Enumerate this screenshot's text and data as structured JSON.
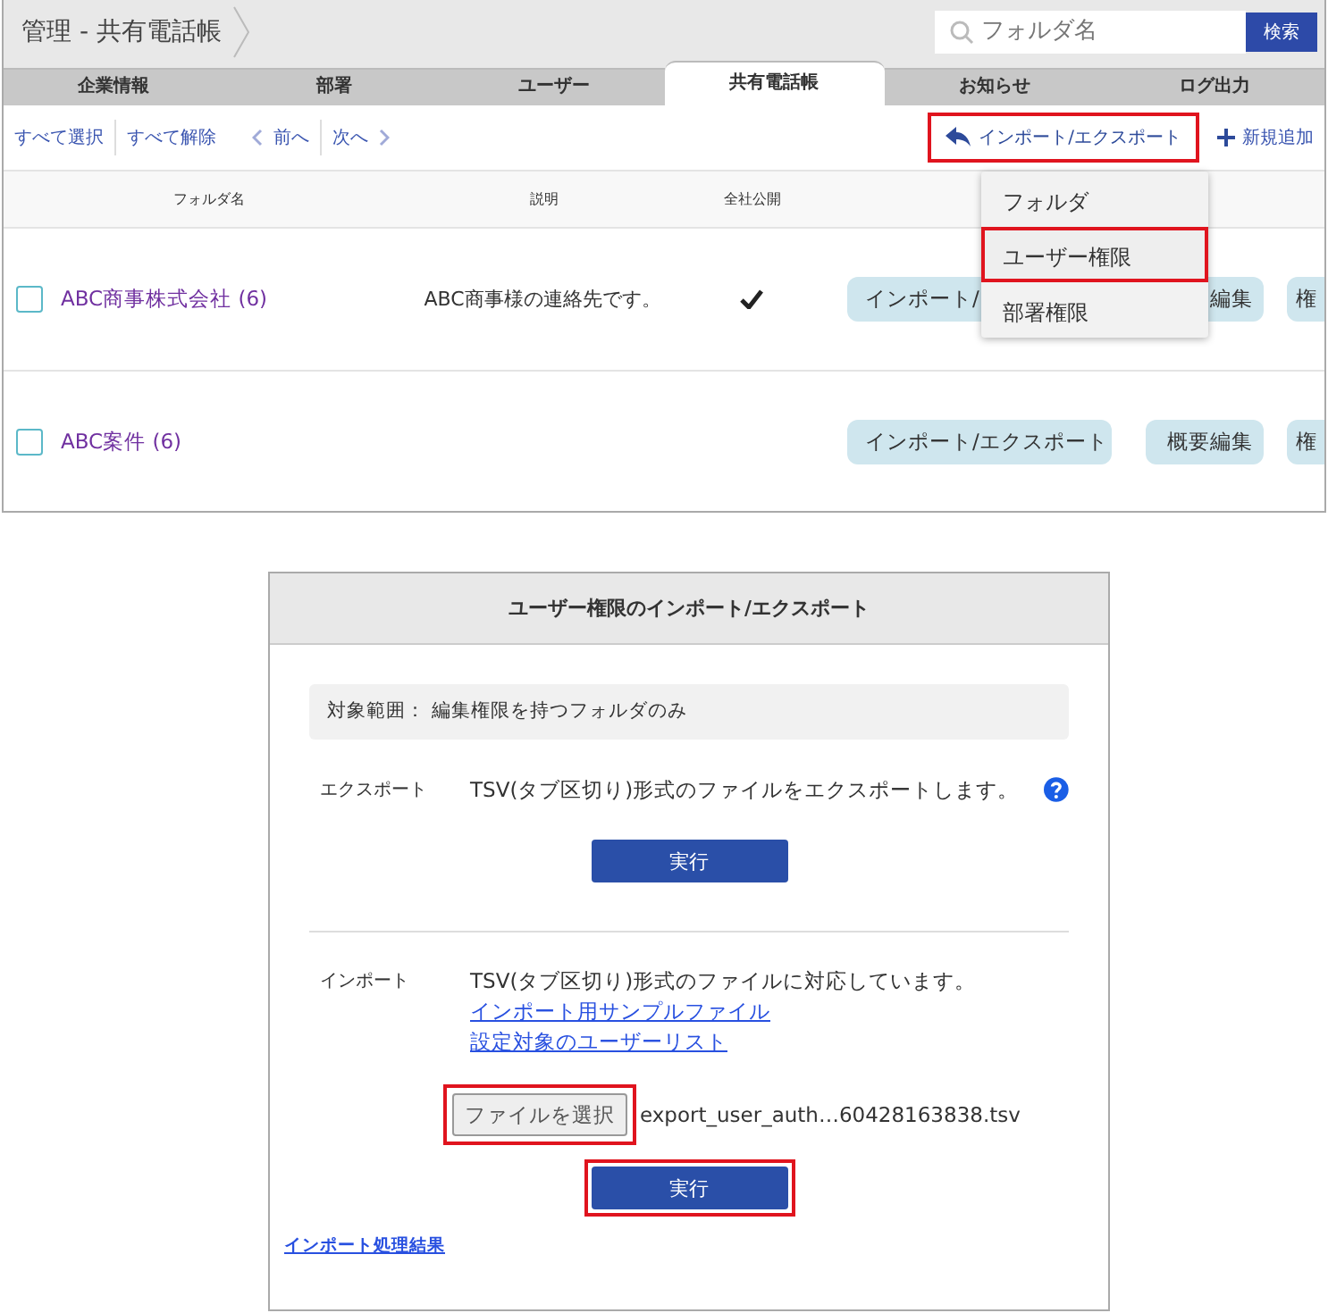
{
  "top": {
    "breadcrumb": "管理 - 共有電話帳",
    "search": {
      "placeholder": "フォルダ名",
      "button": "検索"
    },
    "tabs": [
      {
        "label": "企業情報",
        "selected": false
      },
      {
        "label": "部署",
        "selected": false
      },
      {
        "label": "ユーザー",
        "selected": false
      },
      {
        "label": "共有電話帳",
        "selected": true
      },
      {
        "label": "お知らせ",
        "selected": false
      },
      {
        "label": "ログ出力",
        "selected": false
      }
    ],
    "toolbar": {
      "select_all": "すべて選択",
      "deselect_all": "すべて解除",
      "prev": "前へ",
      "next": "次へ",
      "import_export": {
        "label": "インポート/エクスポート",
        "highlighted": true
      },
      "add": "新規追加"
    },
    "columns": [
      "フォルダ名",
      "説明",
      "全社公開"
    ],
    "rows": [
      {
        "checked": false,
        "name": "ABC商事株式会社 (6)",
        "description": "ABC商事様の連絡先です。",
        "public": true,
        "actions": [
          "インポート/",
          "編集",
          "権"
        ]
      },
      {
        "checked": false,
        "name": "ABC案件 (6)",
        "public": false,
        "actions": [
          "インポート/エクスポート",
          "概要編集",
          "権"
        ]
      }
    ],
    "menu": [
      {
        "label": "フォルダ",
        "highlighted": false
      },
      {
        "label": "ユーザー権限",
        "highlighted": true
      },
      {
        "label": "部署権限",
        "highlighted": false
      }
    ]
  },
  "dialog": {
    "title": "ユーザー権限のインポート/エクスポート",
    "scope": "対象範囲： 編集権限を持つフォルダのみ",
    "export": {
      "label": "エクスポート",
      "text": "TSV(タブ区切り)形式のファイルをエクスポートします。",
      "button": {
        "label": "実行",
        "highlighted": false
      }
    },
    "import": {
      "label": "インポート",
      "text": "TSV(タブ区切り)形式のファイルに対応しています。",
      "links": [
        "インポート用サンプルファイル",
        "設定対象のユーザーリスト"
      ],
      "file_button": {
        "label": "ファイルを選択",
        "highlighted": true
      },
      "file_name": "export_user_auth…60428163838.tsv",
      "button": {
        "label": "実行",
        "highlighted": true
      }
    },
    "result_link": "インポート処理結果"
  }
}
